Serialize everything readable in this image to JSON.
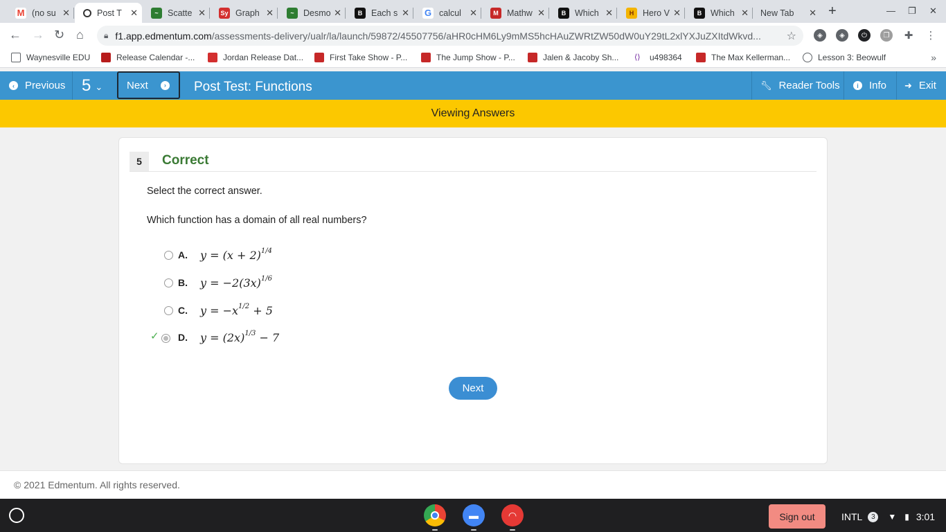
{
  "browser": {
    "tabs": [
      {
        "label": "(no su",
        "icon": "gmail-icon",
        "color": "#ea4335"
      },
      {
        "label": "Post T",
        "icon": "edmentum-icon",
        "color": "#333333",
        "active": true
      },
      {
        "label": "Scatte",
        "icon": "desmos-icon",
        "color": "#2e7d32"
      },
      {
        "label": "Graph",
        "icon": "symbolab-icon",
        "color": "#d32f2f"
      },
      {
        "label": "Desmo",
        "icon": "desmos-icon",
        "color": "#2e7d32"
      },
      {
        "label": "Each s",
        "icon": "brainly-icon",
        "color": "#111111"
      },
      {
        "label": "calcul",
        "icon": "google-icon",
        "color": "#4285f4"
      },
      {
        "label": "Mathw",
        "icon": "mathway-icon",
        "color": "#c62828"
      },
      {
        "label": "Which",
        "icon": "brainly-icon",
        "color": "#111111"
      },
      {
        "label": "Hero V",
        "icon": "hero-icon",
        "color": "#f4b400"
      },
      {
        "label": "Which",
        "icon": "brainly-icon",
        "color": "#111111"
      },
      {
        "label": "New Tab",
        "icon": "",
        "color": ""
      }
    ],
    "url": {
      "host": "f1.app.edmentum.com",
      "path": "/assessments-delivery/ualr/la/launch/59872/45507756/aHR0cHM6Ly9mMS5hcHAuZWRtZW50dW0uY29tL2xlYXJuZXItdWkvd..."
    },
    "bookmarks": [
      {
        "label": "Waynesville EDU",
        "icon": "folder-icon",
        "color": "#5f6368"
      },
      {
        "label": "Release Calendar -...",
        "icon": "site-icon",
        "color": "#b71c1c"
      },
      {
        "label": "Jordan Release Dat...",
        "icon": "site-icon",
        "color": "#d32f2f"
      },
      {
        "label": "First Take Show - P...",
        "icon": "espn-icon",
        "color": "#c62828"
      },
      {
        "label": "The Jump Show - P...",
        "icon": "espn-icon",
        "color": "#c62828"
      },
      {
        "label": "Jalen & Jacoby Sh...",
        "icon": "espn-icon",
        "color": "#c62828"
      },
      {
        "label": "u498364",
        "icon": "brackets-icon",
        "color": "#6a1b9a"
      },
      {
        "label": "The Max Kellerman...",
        "icon": "espn-icon",
        "color": "#c62828"
      },
      {
        "label": "Lesson 3: Beowulf",
        "icon": "globe-icon",
        "color": "#5f6368"
      }
    ]
  },
  "header": {
    "previous": "Previous",
    "question_number": "5",
    "next": "Next",
    "title": "Post Test: Functions",
    "reader_tools": "Reader Tools",
    "info": "Info",
    "exit": "Exit"
  },
  "banner": "Viewing Answers",
  "question": {
    "number": "5",
    "status": "Correct",
    "instruction": "Select the correct answer.",
    "text": "Which function has a domain of all real numbers?",
    "options": [
      {
        "label": "A.",
        "expr_html": "y = (x + 2)<sup>1/4</sup>",
        "selected": false
      },
      {
        "label": "B.",
        "expr_html": "y = −2(3x)<sup>1/6</sup>",
        "selected": false
      },
      {
        "label": "C.",
        "expr_html": "y = −x<sup>1/2</sup> + 5",
        "selected": false
      },
      {
        "label": "D.",
        "expr_html": "y = (2x)<sup>1/3</sup> − 7",
        "selected": true,
        "correct": true
      }
    ],
    "next_button": "Next"
  },
  "footer": "© 2021 Edmentum. All rights reserved.",
  "shelf": {
    "sign_out": "Sign out",
    "input_method": "INTL",
    "notifications": "3",
    "time": "3:01"
  }
}
